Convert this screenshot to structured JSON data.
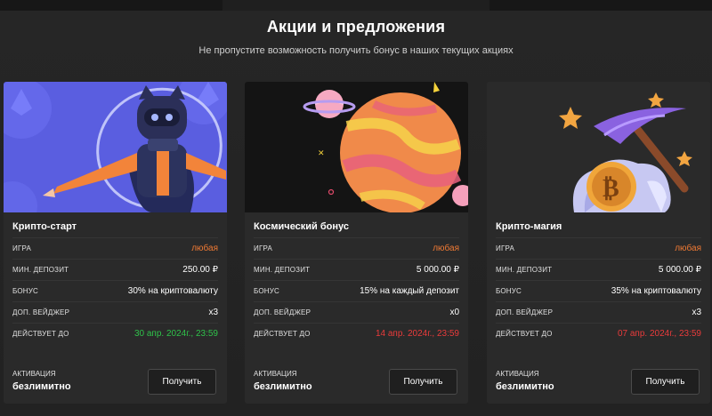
{
  "header": {
    "title": "Акции и предложения",
    "subtitle": "Не пропустите возможность получить бонус в наших текущих акциях"
  },
  "colors": {
    "accent_orange": "#f07a34",
    "status_green": "#2fc24a",
    "status_red": "#ea3b3b"
  },
  "labels": {
    "game": "ИГРА",
    "min_deposit": "МИН. ДЕПОЗИТ",
    "bonus": "БОНУС",
    "wager": "ДОП. ВЕЙДЖЕР",
    "valid_until": "ДЕЙСТВУЕТ ДО",
    "activation": "АКТИВАЦИЯ",
    "get_button": "Получить"
  },
  "cards": [
    {
      "title": "Крипто-старт",
      "image": "crypto-robot-illustration",
      "game": "любая",
      "min_deposit": "250.00 ₽",
      "bonus": "30% на криптовалюту",
      "wager": "x3",
      "valid_until": "30 апр. 2024г., 23:59",
      "valid_status": "active",
      "activation": "безлимитно"
    },
    {
      "title": "Космический бонус",
      "image": "space-planet-illustration",
      "game": "любая",
      "min_deposit": "5 000.00 ₽",
      "bonus": "15% на каждый депозит",
      "wager": "x0",
      "valid_until": "14 апр. 2024г., 23:59",
      "valid_status": "expired",
      "activation": "безлимитно"
    },
    {
      "title": "Крипто-магия",
      "image": "bitcoin-pickaxe-illustration",
      "game": "любая",
      "min_deposit": "5 000.00 ₽",
      "bonus": "35% на криптовалюту",
      "wager": "x3",
      "valid_until": "07 апр. 2024г., 23:59",
      "valid_status": "expired",
      "activation": "безлимитно"
    }
  ]
}
